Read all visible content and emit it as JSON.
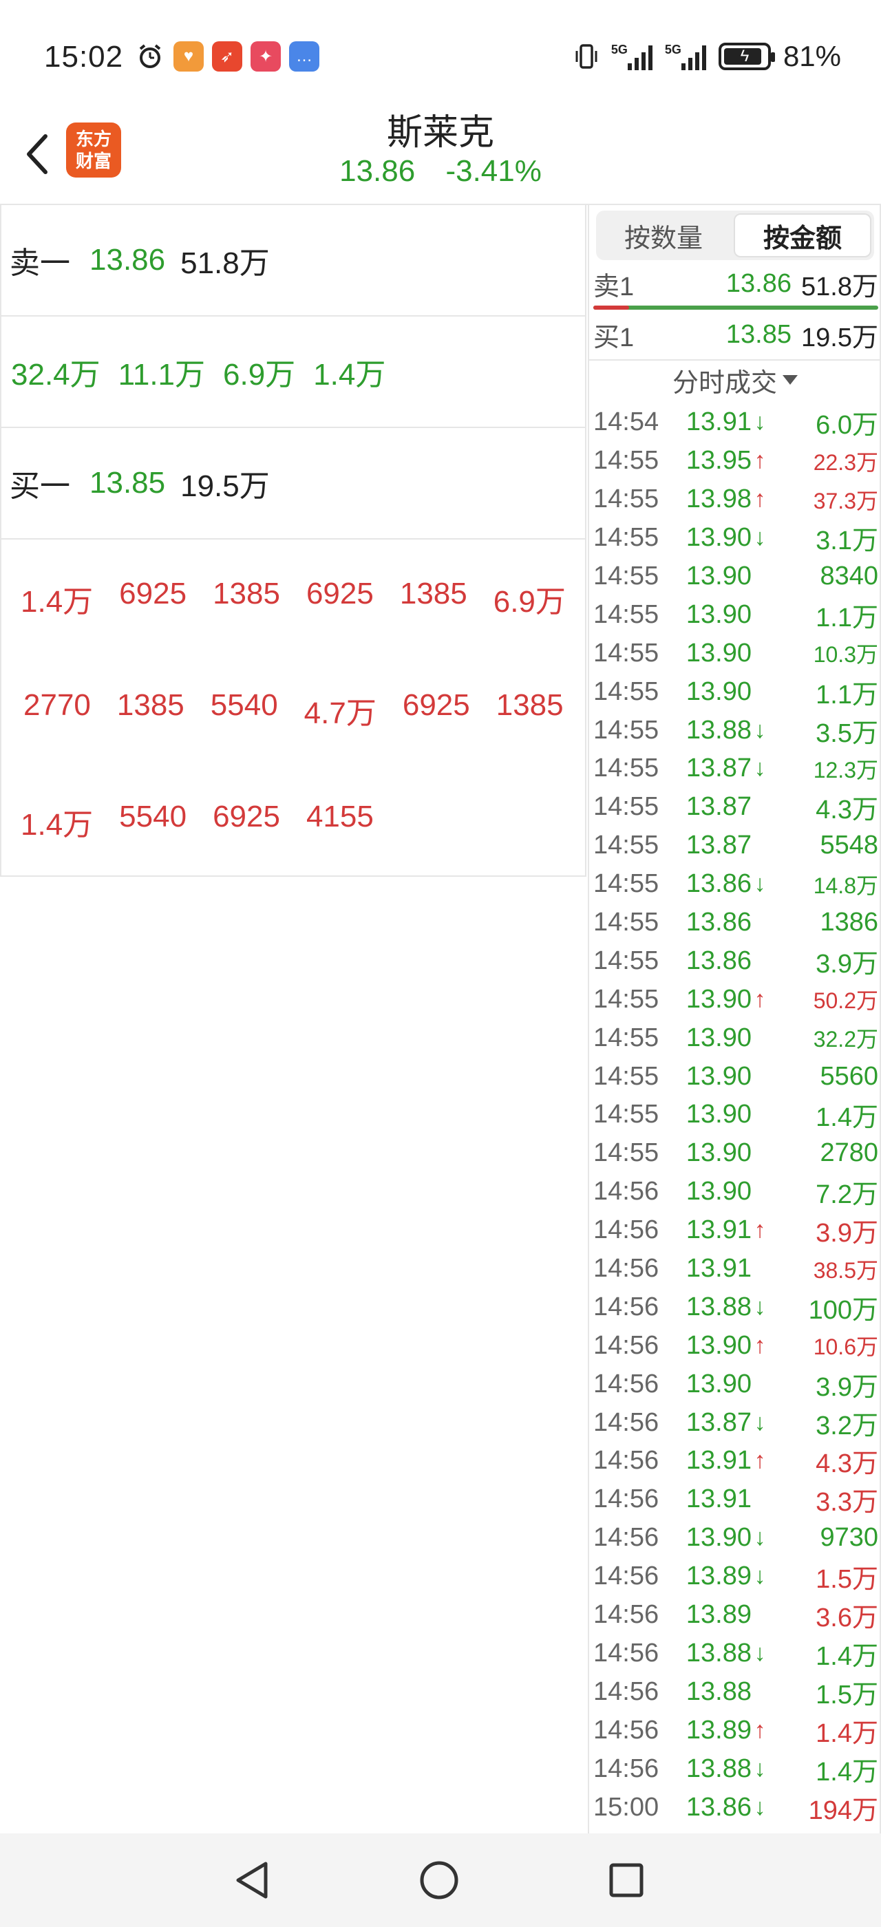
{
  "status_bar": {
    "time": "15:02",
    "battery": "81%",
    "network": "5G",
    "notification_icons": [
      "alarm-icon",
      "heart-app-icon",
      "feather-app-icon",
      "news-app-icon",
      "message-app-icon"
    ]
  },
  "header": {
    "app_logo_line1": "东方",
    "app_logo_line2": "财富",
    "stock_name": "斯莱克",
    "price": "13.86",
    "change_pct": "-3.41%"
  },
  "left": {
    "sell1_label": "卖一",
    "sell1_price": "13.86",
    "sell1_vol": "51.8万",
    "sell_queue": [
      "32.4万",
      "11.1万",
      "6.9万",
      "1.4万"
    ],
    "buy1_label": "买一",
    "buy1_price": "13.85",
    "buy1_vol": "19.5万",
    "buy_queue_rows": [
      [
        "1.4万",
        "6925",
        "1385",
        "6925",
        "1385",
        "6.9万"
      ],
      [
        "2770",
        "1385",
        "5540",
        "4.7万",
        "6925",
        "1385"
      ],
      [
        "1.4万",
        "5540",
        "6925",
        "4155"
      ]
    ]
  },
  "right": {
    "toggle_by_qty": "按数量",
    "toggle_by_amount": "按金额",
    "sell1_label": "卖1",
    "sell1_price": "13.86",
    "sell1_amount": "51.8万",
    "buy1_label": "买1",
    "buy1_price": "13.85",
    "buy1_amount": "19.5万",
    "ticks_title": "分时成交",
    "ticks": [
      {
        "time": "14:54",
        "price": "13.91",
        "dir": "down",
        "vol": "6.0万",
        "vol_color": "green"
      },
      {
        "time": "14:55",
        "price": "13.95",
        "dir": "up",
        "vol": "22.3万",
        "vol_color": "red"
      },
      {
        "time": "14:55",
        "price": "13.98",
        "dir": "up",
        "vol": "37.3万",
        "vol_color": "red"
      },
      {
        "time": "14:55",
        "price": "13.90",
        "dir": "down",
        "vol": "3.1万",
        "vol_color": "green"
      },
      {
        "time": "14:55",
        "price": "13.90",
        "dir": "",
        "vol": "8340",
        "vol_color": "green"
      },
      {
        "time": "14:55",
        "price": "13.90",
        "dir": "",
        "vol": "1.1万",
        "vol_color": "green"
      },
      {
        "time": "14:55",
        "price": "13.90",
        "dir": "",
        "vol": "10.3万",
        "vol_color": "green"
      },
      {
        "time": "14:55",
        "price": "13.90",
        "dir": "",
        "vol": "1.1万",
        "vol_color": "green"
      },
      {
        "time": "14:55",
        "price": "13.88",
        "dir": "down",
        "vol": "3.5万",
        "vol_color": "green"
      },
      {
        "time": "14:55",
        "price": "13.87",
        "dir": "down",
        "vol": "12.3万",
        "vol_color": "green"
      },
      {
        "time": "14:55",
        "price": "13.87",
        "dir": "",
        "vol": "4.3万",
        "vol_color": "green"
      },
      {
        "time": "14:55",
        "price": "13.87",
        "dir": "",
        "vol": "5548",
        "vol_color": "green"
      },
      {
        "time": "14:55",
        "price": "13.86",
        "dir": "down",
        "vol": "14.8万",
        "vol_color": "green"
      },
      {
        "time": "14:55",
        "price": "13.86",
        "dir": "",
        "vol": "1386",
        "vol_color": "green"
      },
      {
        "time": "14:55",
        "price": "13.86",
        "dir": "",
        "vol": "3.9万",
        "vol_color": "green"
      },
      {
        "time": "14:55",
        "price": "13.90",
        "dir": "up",
        "vol": "50.2万",
        "vol_color": "red"
      },
      {
        "time": "14:55",
        "price": "13.90",
        "dir": "",
        "vol": "32.2万",
        "vol_color": "green"
      },
      {
        "time": "14:55",
        "price": "13.90",
        "dir": "",
        "vol": "5560",
        "vol_color": "green"
      },
      {
        "time": "14:55",
        "price": "13.90",
        "dir": "",
        "vol": "1.4万",
        "vol_color": "green"
      },
      {
        "time": "14:55",
        "price": "13.90",
        "dir": "",
        "vol": "2780",
        "vol_color": "green"
      },
      {
        "time": "14:56",
        "price": "13.90",
        "dir": "",
        "vol": "7.2万",
        "vol_color": "green"
      },
      {
        "time": "14:56",
        "price": "13.91",
        "dir": "up",
        "vol": "3.9万",
        "vol_color": "red"
      },
      {
        "time": "14:56",
        "price": "13.91",
        "dir": "",
        "vol": "38.5万",
        "vol_color": "red"
      },
      {
        "time": "14:56",
        "price": "13.88",
        "dir": "down",
        "vol": "100万",
        "vol_color": "green"
      },
      {
        "time": "14:56",
        "price": "13.90",
        "dir": "up",
        "vol": "10.6万",
        "vol_color": "red"
      },
      {
        "time": "14:56",
        "price": "13.90",
        "dir": "",
        "vol": "3.9万",
        "vol_color": "green"
      },
      {
        "time": "14:56",
        "price": "13.87",
        "dir": "down",
        "vol": "3.2万",
        "vol_color": "green"
      },
      {
        "time": "14:56",
        "price": "13.91",
        "dir": "up",
        "vol": "4.3万",
        "vol_color": "red"
      },
      {
        "time": "14:56",
        "price": "13.91",
        "dir": "",
        "vol": "3.3万",
        "vol_color": "red"
      },
      {
        "time": "14:56",
        "price": "13.90",
        "dir": "down",
        "vol": "9730",
        "vol_color": "green"
      },
      {
        "time": "14:56",
        "price": "13.89",
        "dir": "down",
        "vol": "1.5万",
        "vol_color": "red"
      },
      {
        "time": "14:56",
        "price": "13.89",
        "dir": "",
        "vol": "3.6万",
        "vol_color": "red"
      },
      {
        "time": "14:56",
        "price": "13.88",
        "dir": "down",
        "vol": "1.4万",
        "vol_color": "green"
      },
      {
        "time": "14:56",
        "price": "13.88",
        "dir": "",
        "vol": "1.5万",
        "vol_color": "green"
      },
      {
        "time": "14:56",
        "price": "13.89",
        "dir": "up",
        "vol": "1.4万",
        "vol_color": "red"
      },
      {
        "time": "14:56",
        "price": "13.88",
        "dir": "down",
        "vol": "1.4万",
        "vol_color": "green"
      },
      {
        "time": "15:00",
        "price": "13.86",
        "dir": "down",
        "vol": "194万",
        "vol_color": "red"
      }
    ]
  },
  "colors": {
    "up_red": "#d33a3a",
    "down_green": "#2e9d2e",
    "brand_orange": "#ea5a22"
  },
  "nav": {
    "back_icon": "triangle-back-icon",
    "home_icon": "circle-home-icon",
    "recents_icon": "square-recents-icon"
  }
}
